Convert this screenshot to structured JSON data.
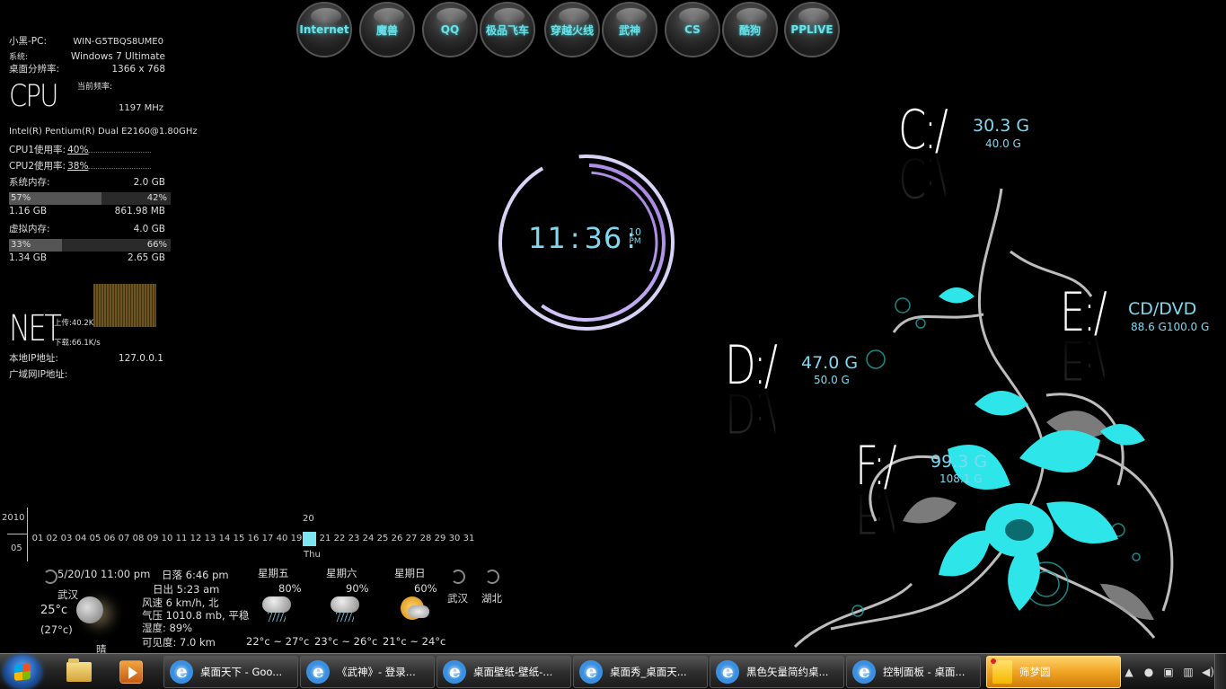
{
  "launcher": {
    "items": [
      "Internet",
      "魔兽",
      "QQ",
      "极品飞车",
      "穿越火线",
      "武神",
      "CS",
      "酷狗",
      "PPLIVE"
    ]
  },
  "sysinfo": {
    "pc_label": "小黑-PC:",
    "pc_name": "WIN-G5TBQS8UME0",
    "os_label": "系统:",
    "os_value": "Windows 7 Ultimate",
    "res_label": "桌面分辨率:",
    "res_value": "1366 x 768",
    "cpu_logo": "CPU",
    "freq_label": "当前频率:",
    "freq_value": "1197 MHz",
    "cpu_model": "Intel(R) Pentium(R) Dual E2160@1.80GHz",
    "cpu1_label": "CPU1使用率:",
    "cpu1_value": "40%",
    "cpu2_label": "CPU2使用率:",
    "cpu2_value": "38%",
    "mem_label": "系统内存:",
    "mem_total": "2.0 GB",
    "mem_used_pct": "57%",
    "mem_free_pct": "42%",
    "mem_used_fraction": 0.57,
    "mem_used": "1.16 GB",
    "mem_free": "861.98 MB",
    "vmem_label": "虚拟内存:",
    "vmem_total": "4.0 GB",
    "vmem_used_pct": "33%",
    "vmem_free_pct": "66%",
    "vmem_used_fraction": 0.33,
    "vmem_used": "1.34 GB",
    "vmem_free": "2.65 GB",
    "net_logo": "NET",
    "upload": "上传:40.2K/s",
    "download": "下载:66.1K/s",
    "local_ip_label": "本地IP地址:",
    "local_ip": "127.0.0.1",
    "wan_ip_label": "广域网IP地址:"
  },
  "clock": {
    "hours": "11",
    "sep": ":",
    "minutes": "36",
    "seconds": "10",
    "ampm": "PM"
  },
  "drives": [
    {
      "letter": "C:/",
      "free": "30.3 G",
      "total": "40.0 G"
    },
    {
      "letter": "D:/",
      "free": "47.0 G",
      "total": "50.0 G"
    },
    {
      "letter": "E:/",
      "free": "CD/DVD",
      "total": "88.6 G100.0 G"
    },
    {
      "letter": "F:/",
      "free": "99.3 G",
      "total": "108.1 G"
    }
  ],
  "calendar": {
    "year": "2010",
    "month": "05",
    "days_before": [
      "01",
      "02",
      "03",
      "04",
      "05",
      "06",
      "07",
      "08",
      "09",
      "10",
      "11",
      "12",
      "13",
      "14",
      "15",
      "16",
      "17",
      "40",
      "19"
    ],
    "today": "20",
    "today_dow": "Thu",
    "days_after": [
      "21",
      "22",
      "23",
      "24",
      "25",
      "26",
      "27",
      "28",
      "29",
      "30",
      "31"
    ]
  },
  "weather": {
    "updated": "5/20/10 11:00 pm",
    "sunset": "日落 6:46 pm",
    "city": "武汉",
    "temp": "25°c",
    "feels": "(27°c)",
    "condition": "晴",
    "sunrise": "日出 5:23 am",
    "wind": "风速 6 km/h, 北",
    "pressure": "气压 1010.8 mb, 平稳",
    "humidity": "湿度: 89%",
    "visibility": "可见度: 7.0 km",
    "forecast": [
      {
        "day": "星期五",
        "pop": "80%",
        "range": "22°c ~ 27°c",
        "icon": "thunderstorm-icon"
      },
      {
        "day": "星期六",
        "pop": "90%",
        "range": "23°c ~ 26°c",
        "icon": "thunderstorm-icon"
      },
      {
        "day": "星期日",
        "pop": "60%",
        "range": "21°c ~ 24°c",
        "icon": "partly-sunny-icon"
      }
    ],
    "loc1": "武汉",
    "loc2": "湖北"
  },
  "taskbar": {
    "tasks": [
      {
        "label": "桌面天下 - Goo...",
        "icon": "ie-icon"
      },
      {
        "label": "《武神》- 登录...",
        "icon": "ie-icon"
      },
      {
        "label": "桌面壁纸-壁纸-...",
        "icon": "ie-icon"
      },
      {
        "label": "桌面秀_桌面天...",
        "icon": "ie-icon"
      },
      {
        "label": "黑色矢量简约桌...",
        "icon": "ie-icon"
      },
      {
        "label": "控制面板 - 桌面...",
        "icon": "ie-icon"
      }
    ],
    "active_task": {
      "label": "筛梦圆",
      "icon": "sticky-note-icon"
    },
    "accent": "#7fd8f0"
  }
}
